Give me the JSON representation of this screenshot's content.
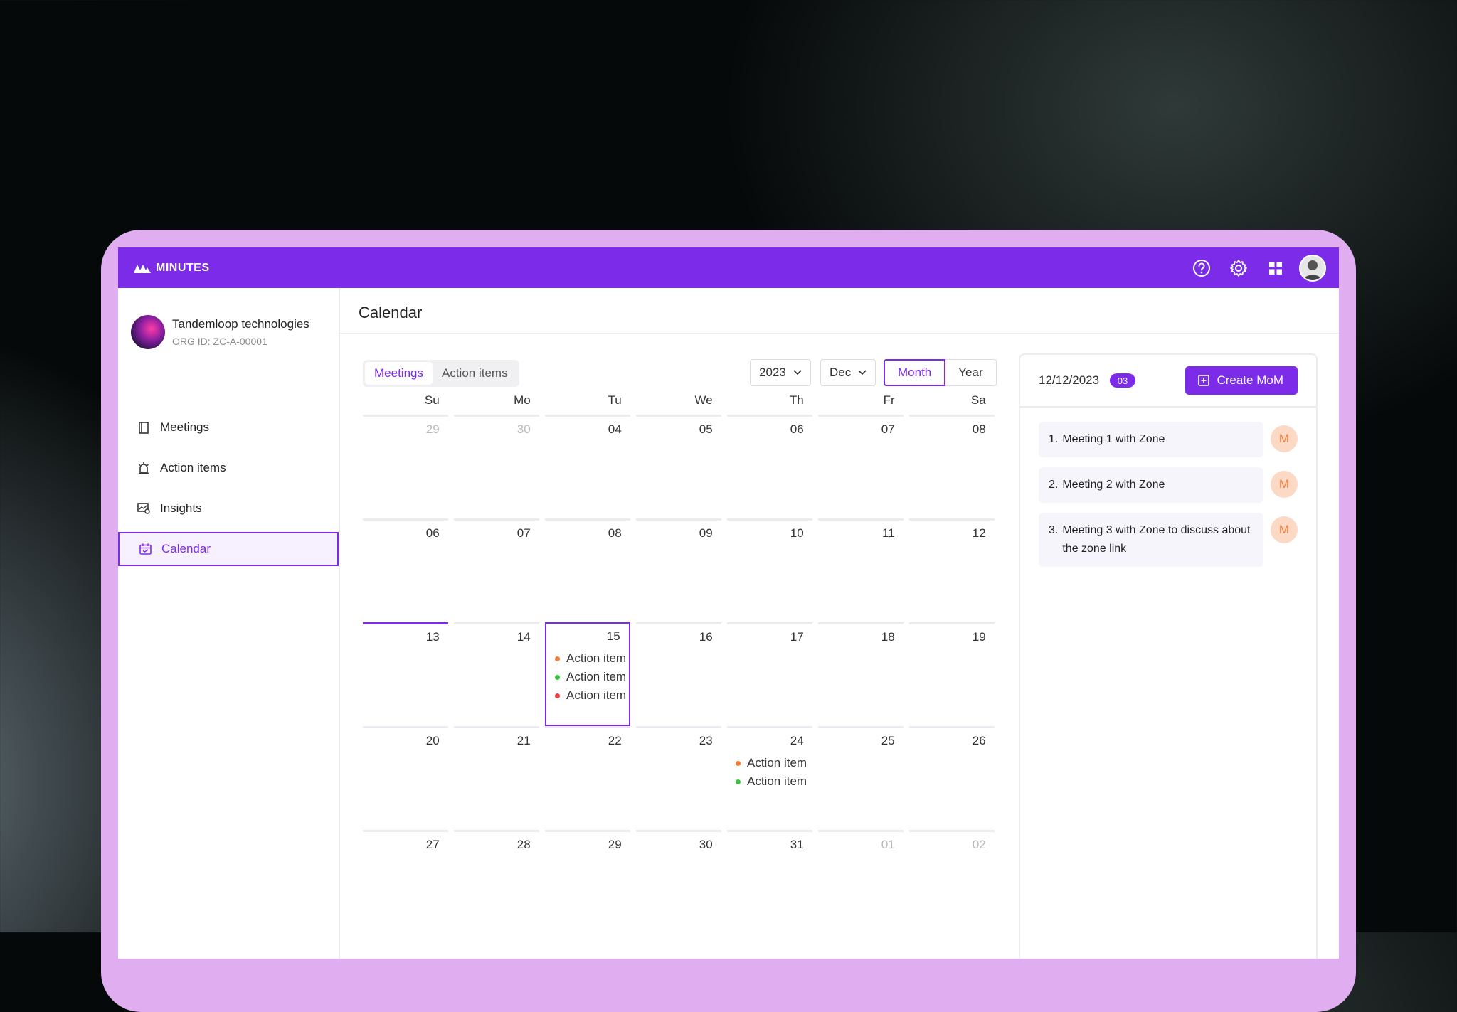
{
  "app": {
    "brand": "MINUTES"
  },
  "header_icons": [
    "help-icon",
    "settings-icon",
    "grid-icon",
    "avatar"
  ],
  "org": {
    "name": "Tandemloop technologies",
    "id": "ORG ID: ZC-A-00001"
  },
  "nav": [
    {
      "label": "Meetings",
      "icon": "book-icon",
      "active": false
    },
    {
      "label": "Action items",
      "icon": "alarm-icon",
      "active": false
    },
    {
      "label": "Insights",
      "icon": "insights-icon",
      "active": false
    },
    {
      "label": "Calendar",
      "icon": "calendar-icon",
      "active": true
    }
  ],
  "page_title": "Calendar",
  "tabs": {
    "meetings": "Meetings",
    "action_items": "Action items"
  },
  "filters": {
    "year": "2023",
    "month": "Dec",
    "view_month": "Month",
    "view_year": "Year"
  },
  "calendar": {
    "weekdays": [
      "Su",
      "Mo",
      "Tu",
      "We",
      "Th",
      "Fr",
      "Sa"
    ],
    "weeks": [
      [
        {
          "n": "29",
          "muted": true
        },
        {
          "n": "30",
          "muted": true
        },
        {
          "n": "04"
        },
        {
          "n": "05"
        },
        {
          "n": "06"
        },
        {
          "n": "07"
        },
        {
          "n": "08"
        }
      ],
      [
        {
          "n": "06"
        },
        {
          "n": "07"
        },
        {
          "n": "08"
        },
        {
          "n": "09"
        },
        {
          "n": "10"
        },
        {
          "n": "11"
        },
        {
          "n": "12"
        }
      ],
      [
        {
          "n": "13",
          "today": true
        },
        {
          "n": "14"
        },
        {
          "n": "15",
          "selected": true,
          "events": [
            {
              "label": "Action item",
              "color": "#f07d3a"
            },
            {
              "label": "Action item",
              "color": "#3cc23c"
            },
            {
              "label": "Action item",
              "color": "#ee3c3c"
            }
          ]
        },
        {
          "n": "16"
        },
        {
          "n": "17"
        },
        {
          "n": "18"
        },
        {
          "n": "19"
        }
      ],
      [
        {
          "n": "20"
        },
        {
          "n": "21"
        },
        {
          "n": "22"
        },
        {
          "n": "23"
        },
        {
          "n": "24",
          "events": [
            {
              "label": "Action item",
              "color": "#f07d3a"
            },
            {
              "label": "Action item",
              "color": "#3cc23c"
            }
          ]
        },
        {
          "n": "25"
        },
        {
          "n": "26"
        }
      ],
      [
        {
          "n": "27"
        },
        {
          "n": "28"
        },
        {
          "n": "29"
        },
        {
          "n": "30"
        },
        {
          "n": "31"
        },
        {
          "n": "01",
          "muted": true
        },
        {
          "n": "02",
          "muted": true
        }
      ]
    ]
  },
  "panel": {
    "date": "12/12/2023",
    "count": "03",
    "create_label": "Create MoM",
    "meetings": [
      {
        "index": "1.",
        "title": "Meeting 1 with Zone",
        "avatar": "M"
      },
      {
        "index": "2.",
        "title": "Meeting 2 with Zone",
        "avatar": "M"
      },
      {
        "index": "3.",
        "title": "Meeting 3 with Zone to discuss about the zone link",
        "avatar": "M"
      }
    ]
  },
  "colors": {
    "accent": "#7c2be8",
    "frame": "#e0aef0",
    "avatar_bg": "#fcd9c4",
    "avatar_fg": "#f08040"
  }
}
